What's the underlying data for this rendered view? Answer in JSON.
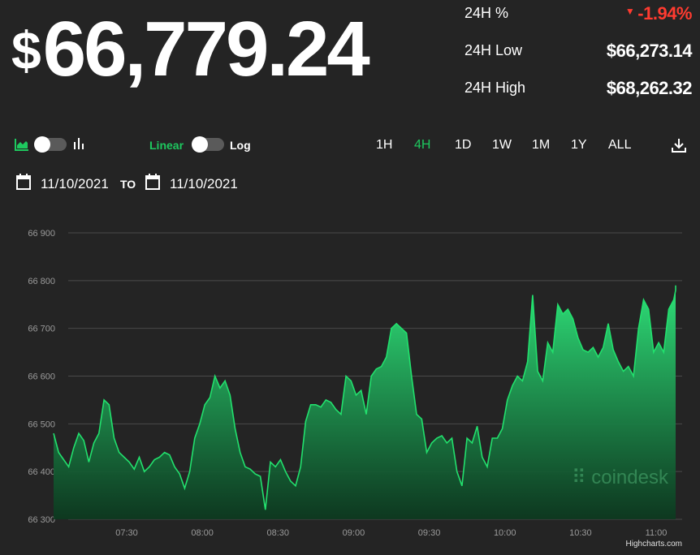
{
  "header": {
    "price": "66,779.24",
    "currency_symbol": "$"
  },
  "stats": {
    "change_label": "24H %",
    "change_value": "-1.94%",
    "low_label": "24H Low",
    "low_value": "$66,273.14",
    "high_label": "24H High",
    "high_value": "$68,262.32"
  },
  "controls": {
    "linear_label": "Linear",
    "log_label": "Log",
    "ranges": [
      "1H",
      "4H",
      "1D",
      "1W",
      "1M",
      "1Y",
      "ALL"
    ],
    "active_range": "4H",
    "download_icon": "download-icon",
    "area_icon": "area-chart-icon",
    "bar_icon": "bar-chart-icon"
  },
  "dates": {
    "from": "11/10/2021",
    "to_label": "TO",
    "to": "11/10/2021"
  },
  "colors": {
    "accent": "#1ec95f",
    "negative": "#ff3b30",
    "background": "#242424"
  },
  "watermark": "coindesk",
  "credit": "Highcharts.com",
  "chart_data": {
    "type": "area",
    "yticks": [
      "66 900",
      "66 800",
      "66 700",
      "66 600",
      "66 500",
      "66 400",
      "66 300"
    ],
    "ytick_values": [
      66900,
      66800,
      66700,
      66600,
      66500,
      66400,
      66300
    ],
    "ylim": [
      66300,
      66900
    ],
    "xticks": [
      "07:30",
      "08:00",
      "08:30",
      "09:00",
      "09:30",
      "10:00",
      "10:30",
      "11:00"
    ],
    "xtick_minutes": [
      450,
      480,
      510,
      540,
      570,
      600,
      630,
      660
    ],
    "xlim_minutes": [
      420,
      672
    ],
    "grid": true,
    "x_minutes": [
      421,
      423,
      425,
      427,
      429,
      431,
      433,
      435,
      437,
      439,
      441,
      443,
      445,
      447,
      449,
      451,
      453,
      455,
      457,
      459,
      461,
      463,
      465,
      467,
      469,
      471,
      473,
      475,
      477,
      479,
      481,
      483,
      485,
      487,
      489,
      491,
      493,
      495,
      497,
      499,
      501,
      503,
      505,
      507,
      509,
      511,
      513,
      515,
      517,
      519,
      521,
      523,
      525,
      527,
      529,
      531,
      533,
      535,
      537,
      539,
      541,
      543,
      545,
      547,
      549,
      551,
      553,
      555,
      557,
      559,
      561,
      563,
      565,
      567,
      569,
      571,
      573,
      575,
      577,
      579,
      581,
      583,
      585,
      587,
      589,
      591,
      593,
      595,
      597,
      599,
      601,
      603,
      605,
      607,
      609,
      611,
      613,
      615,
      617,
      619,
      621,
      623,
      625,
      627,
      629,
      631,
      633,
      635,
      637,
      639,
      641,
      643,
      645,
      647,
      649,
      651,
      653,
      655,
      657,
      659,
      661,
      663,
      665,
      667,
      669,
      671
    ],
    "values": [
      66480,
      66440,
      66425,
      66410,
      66450,
      66480,
      66465,
      66420,
      66460,
      66480,
      66550,
      66540,
      66470,
      66440,
      66430,
      66420,
      66405,
      66430,
      66400,
      66410,
      66425,
      66430,
      66440,
      66435,
      66410,
      66395,
      66365,
      66400,
      66470,
      66500,
      66540,
      66555,
      66600,
      66575,
      66590,
      66560,
      66490,
      66440,
      66410,
      66405,
      66395,
      66390,
      66320,
      66420,
      66410,
      66425,
      66400,
      66380,
      66370,
      66410,
      66505,
      66540,
      66540,
      66535,
      66550,
      66545,
      66530,
      66520,
      66600,
      66590,
      66560,
      66570,
      66520,
      66600,
      66615,
      66620,
      66640,
      66700,
      66710,
      66700,
      66690,
      66600,
      66520,
      66510,
      66440,
      66460,
      66470,
      66475,
      66460,
      66470,
      66400,
      66370,
      66470,
      66460,
      66495,
      66430,
      66410,
      66470,
      66470,
      66490,
      66550,
      66580,
      66600,
      66590,
      66630,
      66770,
      66610,
      66590,
      66670,
      66650,
      66750,
      66730,
      66740,
      66720,
      66680,
      66655,
      66650,
      66660,
      66640,
      66660,
      66710,
      66655,
      66630,
      66610,
      66620,
      66600,
      66700,
      66760,
      66740,
      66650,
      66670,
      66650,
      66740,
      66760,
      66780,
      66790
    ]
  }
}
